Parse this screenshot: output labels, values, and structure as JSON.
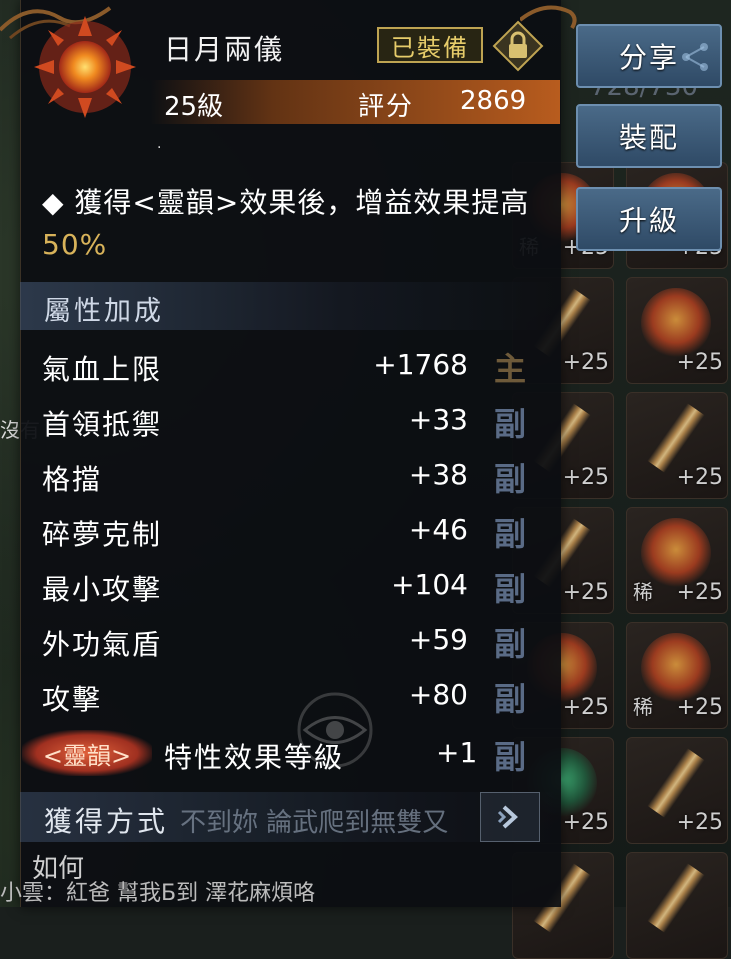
{
  "background": {
    "left_text": "沒有",
    "bottom_text": "小雲：紅爸 幫我Б到 澤花麻煩咯",
    "inventory_count": "728/730"
  },
  "inventory": {
    "slots": [
      {
        "rare": "稀",
        "level": "+25",
        "art": "orange"
      },
      {
        "rare": "",
        "level": "+25",
        "art": "orange"
      },
      {
        "rare": "",
        "level": "+25",
        "art": "blade"
      },
      {
        "rare": "",
        "level": "+25",
        "art": "orange"
      },
      {
        "rare": "",
        "level": "+25",
        "art": "blade"
      },
      {
        "rare": "",
        "level": "+25",
        "art": "blade"
      },
      {
        "rare": "",
        "level": "+25",
        "art": "blade"
      },
      {
        "rare": "稀",
        "level": "+25",
        "art": "orange"
      },
      {
        "rare": "",
        "level": "+25",
        "art": "orange"
      },
      {
        "rare": "稀",
        "level": "+25",
        "art": "orange"
      },
      {
        "rare": "",
        "level": "+25",
        "art": "green"
      },
      {
        "rare": "",
        "level": "+25",
        "art": "blade"
      }
    ]
  },
  "actions": {
    "share": "分享",
    "equip": "裝配",
    "upgrade": "升級"
  },
  "item": {
    "name": "日月兩儀",
    "status": "已裝備",
    "level": "25級",
    "score_label": "評分",
    "score": "2869",
    "dot": "·",
    "effect_prefix": "◆ 獲得<靈韻>效果後，增益效果提高",
    "effect_pct": "50%"
  },
  "attributes": {
    "header": "屬性加成",
    "rows": [
      {
        "name": "氣血上限",
        "value": "+1768",
        "tag": "主"
      },
      {
        "name": "首領抵禦",
        "value": "+33",
        "tag": "副"
      },
      {
        "name": "格擋",
        "value": "+38",
        "tag": "副"
      },
      {
        "name": "碎夢克制",
        "value": "+46",
        "tag": "副"
      },
      {
        "name": "最小攻擊",
        "value": "+104",
        "tag": "副"
      },
      {
        "name": "外功氣盾",
        "value": "+59",
        "tag": "副"
      },
      {
        "name": "攻擊",
        "value": "+80",
        "tag": "副"
      }
    ],
    "trait": {
      "badge": "<靈韻>",
      "name": "特性效果等級",
      "value": "+1",
      "tag": "副"
    }
  },
  "acquire": {
    "title": "獲得方式",
    "chat_overlay": "不到妳 論武爬到無雙又",
    "description": "如何"
  },
  "colors": {
    "accent_gold": "#d8b35a",
    "button_blue": "#3b5a78",
    "level_bar": "#b85c1e"
  }
}
